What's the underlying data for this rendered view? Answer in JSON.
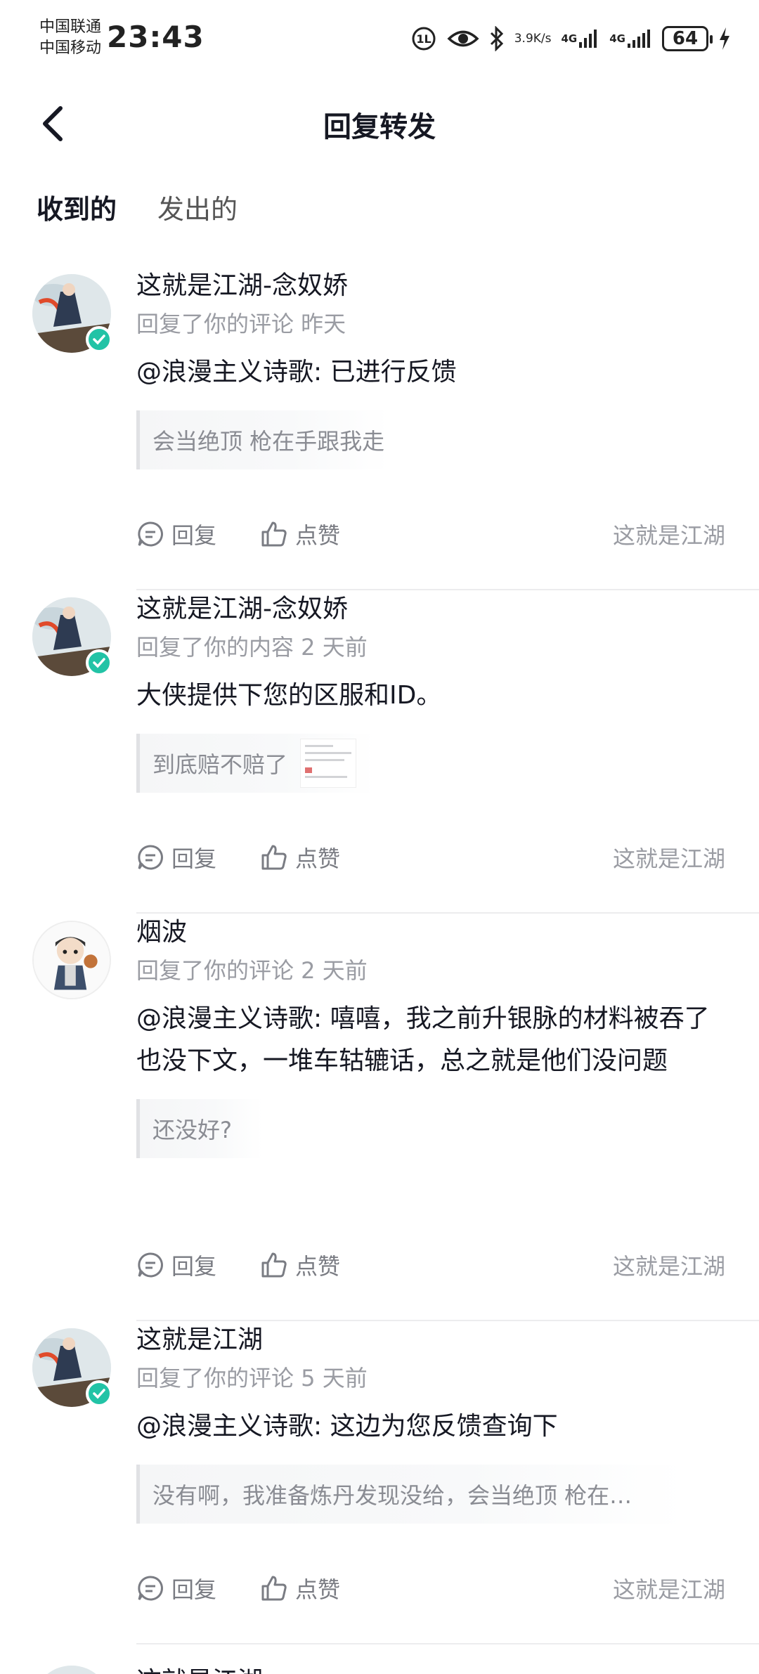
{
  "status_bar": {
    "carrier1": "中国联通",
    "carrier2": "中国移动",
    "time": "23:43",
    "speed_value": "3.9",
    "speed_unit": "K/s",
    "net1": "4G",
    "net2": "4G",
    "battery": "64"
  },
  "header": {
    "title": "回复转发"
  },
  "tabs": [
    {
      "label": "收到的",
      "active": true
    },
    {
      "label": "发出的",
      "active": false
    }
  ],
  "actions": {
    "reply": "回复",
    "like": "点赞"
  },
  "items": [
    {
      "name": "这就是江湖-念奴娇",
      "meta": "回复了你的评论 昨天",
      "text": "@浪漫主义诗歌: 已进行反馈",
      "quote": "会当绝顶 枪在手跟我走",
      "source": "这就是江湖",
      "verified": true
    },
    {
      "name": "这就是江湖-念奴娇",
      "meta": "回复了你的内容 2 天前",
      "text": "大侠提供下您的区服和ID。",
      "quote": "到底赔不赔了",
      "source": "这就是江湖",
      "verified": true
    },
    {
      "name": "烟波",
      "meta": "回复了你的评论 2 天前",
      "text": "@浪漫主义诗歌: 嘻嘻，我之前升银脉的材料被吞了也没下文，一堆车轱辘话，总之就是他们没问题",
      "quote": "还没好?",
      "source": "这就是江湖",
      "verified": false
    },
    {
      "name": "这就是江湖",
      "meta": "回复了你的评论 5 天前",
      "text": "@浪漫主义诗歌: 这边为您反馈查询下",
      "quote": "没有啊，我准备炼丹发现没给，会当绝顶 枪在…",
      "source": "这就是江湖",
      "verified": true
    }
  ],
  "partial_item_name": "这就是江湖",
  "colors": {
    "accent": "#3ed0c0",
    "verified": "#22c3a6",
    "secondary_text": "#9a9ca3"
  }
}
